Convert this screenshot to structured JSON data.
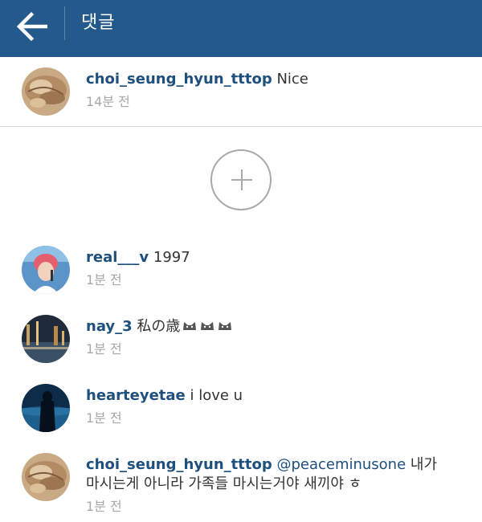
{
  "header": {
    "title": "댓글",
    "back_icon": "arrow-left-icon",
    "background": "#245a8b"
  },
  "pinned_comment": {
    "username": "choi_seung_hyun_tttop",
    "text": "Nice",
    "time": "14분 전"
  },
  "load_more": {
    "icon": "plus-icon"
  },
  "comments": [
    {
      "username": "real___v",
      "text": "1997",
      "time": "1분 전"
    },
    {
      "username": "nay_3",
      "text": "私の歳",
      "emoji": "cat-face-emoji",
      "time": "1분 전"
    },
    {
      "username": "hearteyetae",
      "text": "i love u",
      "time": "1분 전"
    },
    {
      "username": "choi_seung_hyun_tttop",
      "mention": "@peaceminusone",
      "text_line1": "내가",
      "text_line2": "마시는게 아니라 가족들 마시는거야 새끼야 ㅎ",
      "time": "1분 전"
    }
  ],
  "colors": {
    "username": "#1e4f7d",
    "timestamp": "#a8a8a8",
    "accent": "#245a8b"
  }
}
